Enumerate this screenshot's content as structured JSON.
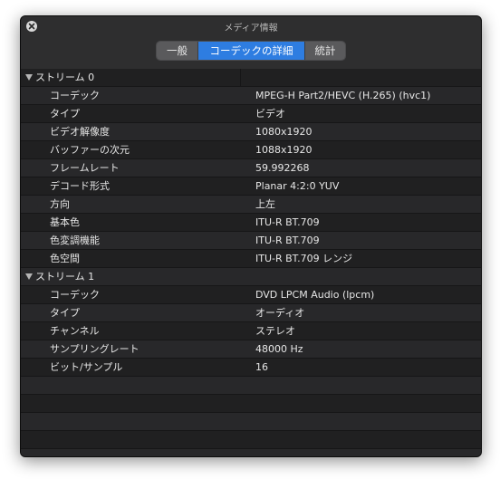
{
  "window": {
    "title": "メディア情報"
  },
  "tabs": [
    {
      "label": "一般"
    },
    {
      "label": "コーデックの詳細"
    },
    {
      "label": "統計"
    }
  ],
  "streams": [
    {
      "title": "ストリーム 0",
      "rows": [
        {
          "label": "コーデック",
          "value": "MPEG-H Part2/HEVC (H.265) (hvc1)"
        },
        {
          "label": "タイプ",
          "value": "ビデオ"
        },
        {
          "label": "ビデオ解像度",
          "value": "1080x1920"
        },
        {
          "label": "バッファーの次元",
          "value": "1088x1920"
        },
        {
          "label": "フレームレート",
          "value": "59.992268"
        },
        {
          "label": "デコード形式",
          "value": "Planar 4:2:0 YUV"
        },
        {
          "label": "方向",
          "value": "上左"
        },
        {
          "label": "基本色",
          "value": "ITU-R BT.709"
        },
        {
          "label": "色変調機能",
          "value": "ITU-R BT.709"
        },
        {
          "label": "色空間",
          "value": "ITU-R BT.709 レンジ"
        }
      ]
    },
    {
      "title": "ストリーム 1",
      "rows": [
        {
          "label": "コーデック",
          "value": "DVD LPCM Audio (lpcm)"
        },
        {
          "label": "タイプ",
          "value": "オーディオ"
        },
        {
          "label": "チャンネル",
          "value": "ステレオ"
        },
        {
          "label": "サンプリングレート",
          "value": "48000 Hz"
        },
        {
          "label": "ビット/サンプル",
          "value": "16"
        }
      ]
    }
  ]
}
